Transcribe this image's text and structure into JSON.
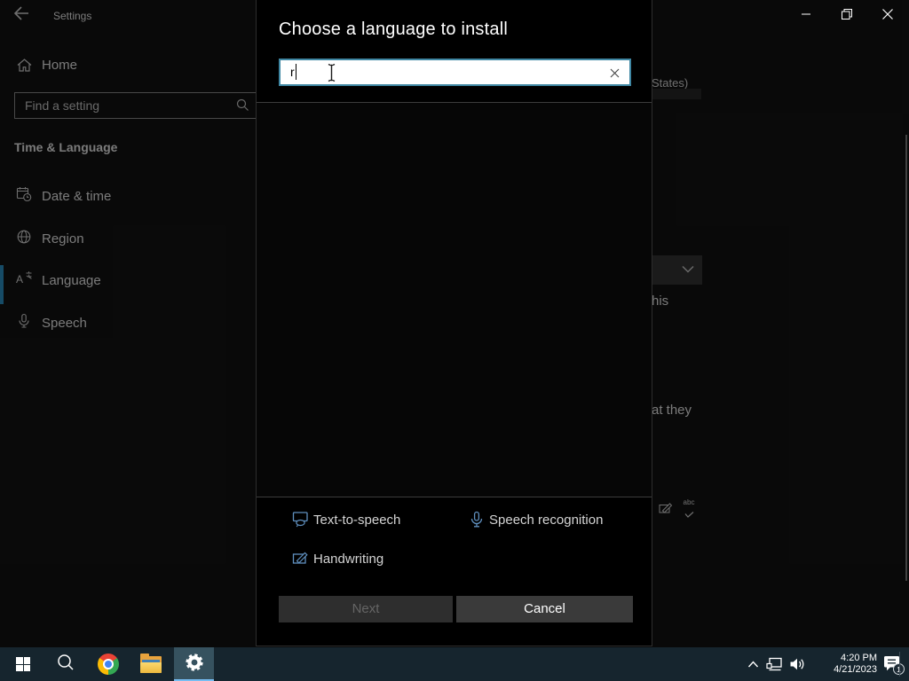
{
  "titlebar": {
    "app_title": "Settings"
  },
  "sidebar": {
    "home_label": "Home",
    "search_placeholder": "Find a setting",
    "section_heading": "Time & Language",
    "nav_items": [
      "Date & time",
      "Region",
      "Language",
      "Speech"
    ],
    "selected_item": "Language"
  },
  "page_fragments": {
    "language_name_fragment": "States)",
    "sentence_fragment_1": "his",
    "sentence_fragment_2": "at they"
  },
  "dialog": {
    "title": "Choose a language to install",
    "search": {
      "value": "r"
    },
    "legend": [
      {
        "icon": "text-to-speech-icon",
        "label": "Text-to-speech"
      },
      {
        "icon": "speech-recognition-icon",
        "label": "Speech recognition"
      },
      {
        "icon": "handwriting-icon",
        "label": "Handwriting"
      }
    ],
    "next_button": "Next",
    "cancel_button": "Cancel"
  },
  "taskbar": {
    "clock": {
      "time": "4:20 PM",
      "date": "4/21/2023"
    },
    "notification_badge": "1",
    "bg_icon_caption": "abc"
  },
  "colors": {
    "input_accent_border": "#3f87a3",
    "selected_accent_bar": "#2e9ed6",
    "taskbar_bg": "#16252e",
    "taskbar_active_underline": "#76bdf2",
    "legend_icon_blue": "#5f8fbe"
  }
}
